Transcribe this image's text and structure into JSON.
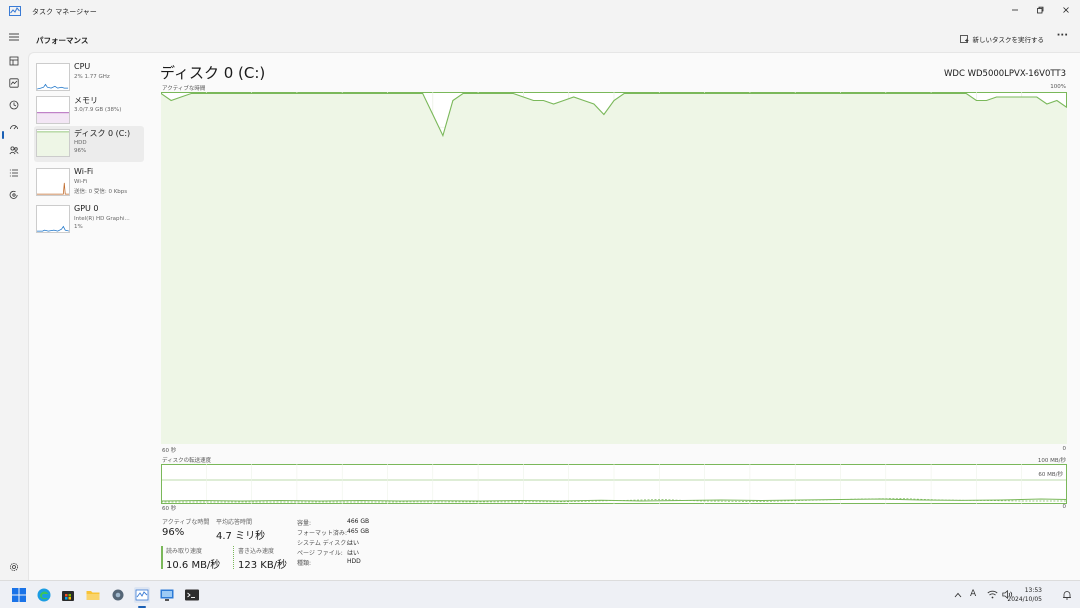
{
  "window": {
    "title": "タスク マネージャー"
  },
  "toolbar": {
    "heading": "パフォーマンス",
    "new_task": "新しいタスクを実行する",
    "more": "···"
  },
  "perf_list": [
    {
      "name": "CPU",
      "sub1": "2%  1.77 GHz",
      "sub2": ""
    },
    {
      "name": "メモリ",
      "sub1": "3.0/7.9 GB (38%)",
      "sub2": ""
    },
    {
      "name": "ディスク 0 (C:)",
      "sub1": "HDD",
      "sub2": "96%"
    },
    {
      "name": "Wi-Fi",
      "sub1": "Wi-Fi",
      "sub2": "送信: 0  受信: 0 Kbps"
    },
    {
      "name": "GPU 0",
      "sub1": "Intel(R) HD Graphi...",
      "sub2": "1%"
    }
  ],
  "disk": {
    "title": "ディスク 0 (C:)",
    "model": "WDC WD5000LPVX-16V0TT3",
    "active_label": "アクティブな時間",
    "active_max": "100%",
    "time_left": "60 秒",
    "time_right": "0",
    "transfer_label": "ディスクの転送速度",
    "transfer_max": "100 MB/秒",
    "transfer_mid": "60 MB/秒",
    "transfer_left": "60 秒",
    "transfer_right": "0"
  },
  "stats": {
    "active_time_label": "アクティブな時間",
    "active_time_value": "96%",
    "avg_response_label": "平均応答時間",
    "avg_response_value": "4.7 ミリ秒",
    "read_label": "読み取り速度",
    "read_value": "10.6 MB/秒",
    "write_label": "書き込み速度",
    "write_value": "123 KB/秒"
  },
  "properties": [
    {
      "key": "容量:",
      "value": "466 GB"
    },
    {
      "key": "フォーマット済み:",
      "value": "465 GB"
    },
    {
      "key": "システム ディスク:",
      "value": "はい"
    },
    {
      "key": "ページ ファイル:",
      "value": "はい"
    },
    {
      "key": "種類:",
      "value": "HDD"
    }
  ],
  "clock": {
    "time": "13:53",
    "date": "2024/10/05"
  },
  "tray": {
    "ime": "A"
  },
  "colors": {
    "disk_line": "#7ab85a",
    "disk_fill": "#eef6e6",
    "cpu": "#1a73c8",
    "memory": "#9a37a7",
    "wifi": "#c06a2b",
    "gpu": "#1a73c8"
  },
  "chart_data": {
    "type": "area",
    "title": "アクティブな時間",
    "xlabel": "",
    "ylabel": "",
    "ylim": [
      0,
      100
    ],
    "x_range": [
      "60 秒",
      "0"
    ],
    "series": [
      {
        "values": [
          100,
          98,
          99,
          100,
          100,
          100,
          100,
          100,
          100,
          100,
          100,
          100,
          100,
          100,
          100,
          100,
          100,
          100,
          100,
          100,
          100,
          100,
          100,
          100,
          100,
          100,
          100,
          94,
          88,
          98,
          100,
          100,
          100,
          100,
          100,
          100,
          99,
          98,
          98,
          97,
          98,
          99,
          98,
          97,
          94,
          98,
          100,
          100,
          100,
          100,
          100,
          100,
          100,
          100,
          100,
          100,
          100,
          100,
          100,
          100,
          100,
          100,
          100,
          100,
          100,
          100,
          100,
          100,
          100,
          100,
          100,
          100,
          100,
          100,
          100,
          100,
          100,
          100,
          100,
          100,
          100,
          98,
          98,
          99,
          99,
          99,
          99,
          99,
          97,
          98,
          96
        ]
      }
    ]
  }
}
